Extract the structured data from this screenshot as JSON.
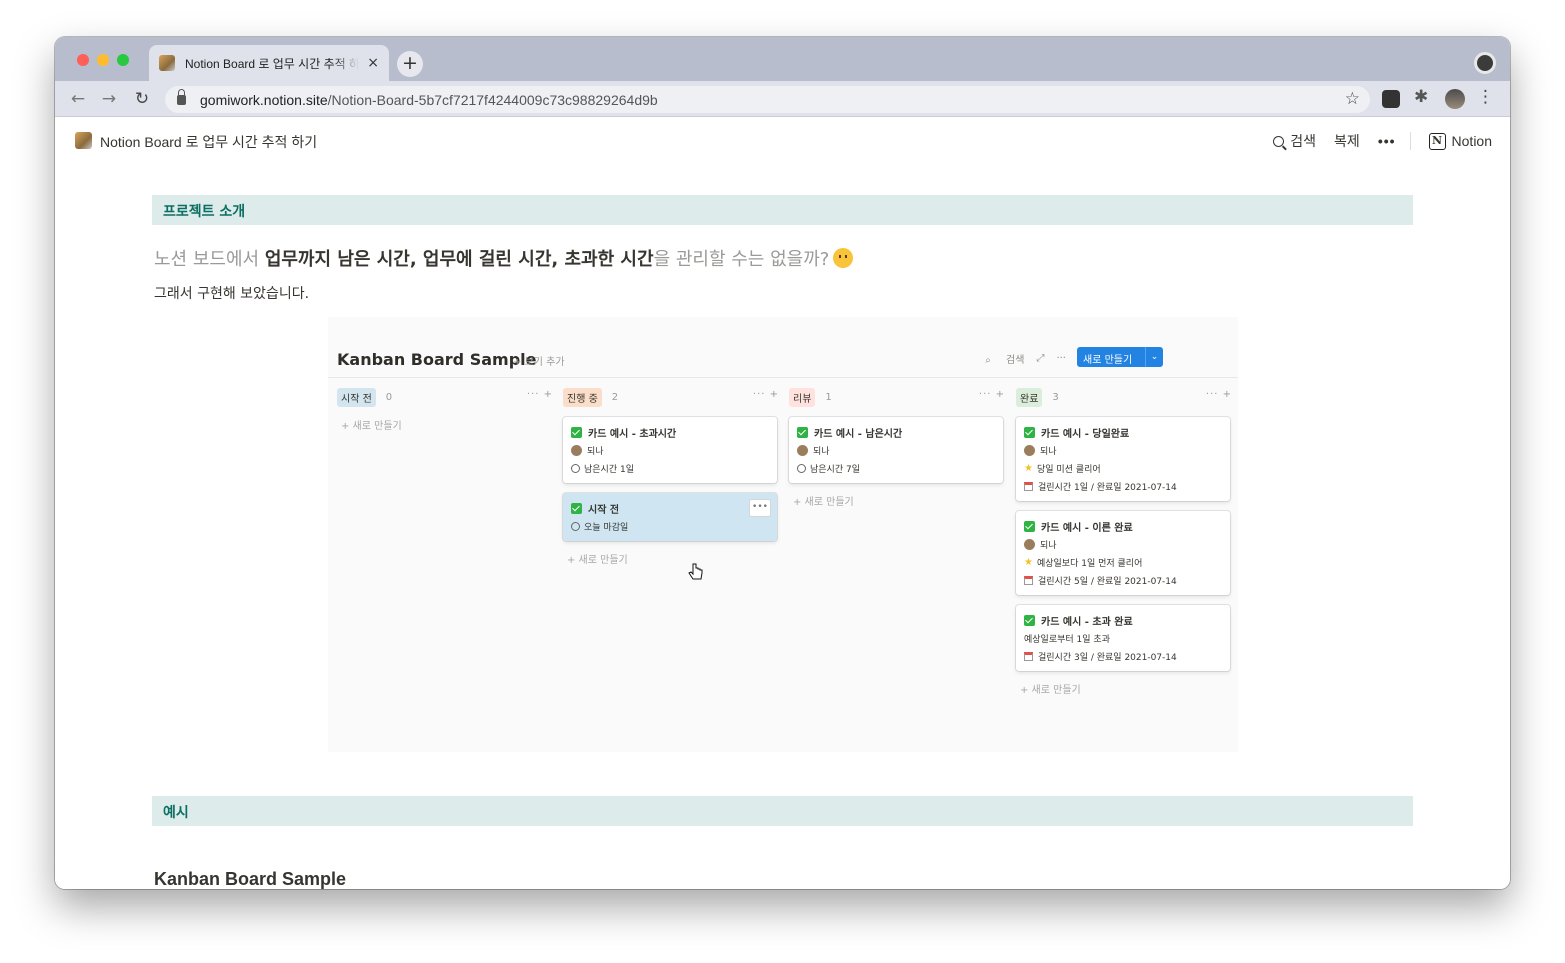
{
  "browser": {
    "tab_title": "Notion Board 로 업무 시간 추적 하기",
    "new_tab_label": "+",
    "tab_close": "×",
    "url_host": "gomiwork.notion.site",
    "url_path": "/Notion-Board-5b7cf7217f4244009c73c98829264d9b",
    "back": "←",
    "forward": "→",
    "reload": "↻",
    "bookmark": "☆",
    "menu": "⋮"
  },
  "topbar": {
    "page_title": "Notion Board 로 업무 시간 추적 하기",
    "search": "검색",
    "duplicate": "복제",
    "more": "•••",
    "notion": "Notion",
    "notion_logo": "N"
  },
  "sections": {
    "intro_callout": "프로젝트 소개",
    "heading_part1": "노션 보드에서 ",
    "heading_part2": "업무까지 남은 시간, 업무에 걸린 시간, 초과한 시간",
    "heading_part3": "을 관리할 수는 없을까?",
    "sub": "그래서 구현해 보았습니다.",
    "example_callout": "예시",
    "example_heading": "Kanban Board Sample"
  },
  "board": {
    "title": "Kanban Board Sample",
    "add_view": "+ 보기 추가",
    "search": "검색",
    "expand": "⤢",
    "more": "···",
    "new_button": "새로 만들기",
    "new_caret": "⌄",
    "add_new": "+ 새로 만들기",
    "columns": [
      {
        "name": "시작 전",
        "count": "0",
        "color": "#d3e5ef",
        "cards": []
      },
      {
        "name": "진행 중",
        "count": "2",
        "color": "#fadec9",
        "cards": [
          {
            "title": "카드 예시 - 초과시간",
            "assignee": "되나",
            "info": "남은시간 1일"
          },
          {
            "title": "시작 전",
            "info": "오늘 마감일",
            "selected": true
          }
        ]
      },
      {
        "name": "리뷰",
        "count": "1",
        "color": "#ffe2dd",
        "cards": [
          {
            "title": "카드 예시 - 남은시간",
            "assignee": "되나",
            "info": "남은시간 7일"
          }
        ]
      },
      {
        "name": "완료",
        "count": "3",
        "color": "#dbeddb",
        "cards": [
          {
            "title": "카드 예시 - 당일완료",
            "assignee": "되나",
            "star": "당일 미션 클리어",
            "date": "걸린시간 1일 / 완료일 2021-07-14"
          },
          {
            "title": "카드 예시 - 이른 완료",
            "assignee": "되나",
            "star": "예상일보다 1일 먼저 클리어",
            "date": "걸린시간 5일 / 완료일 2021-07-14"
          },
          {
            "title": "카드 예시 - 초과 완료",
            "plain": "예상일로부터 1일 초과",
            "date": "걸린시간 3일 / 완료일 2021-07-14"
          }
        ]
      }
    ]
  }
}
